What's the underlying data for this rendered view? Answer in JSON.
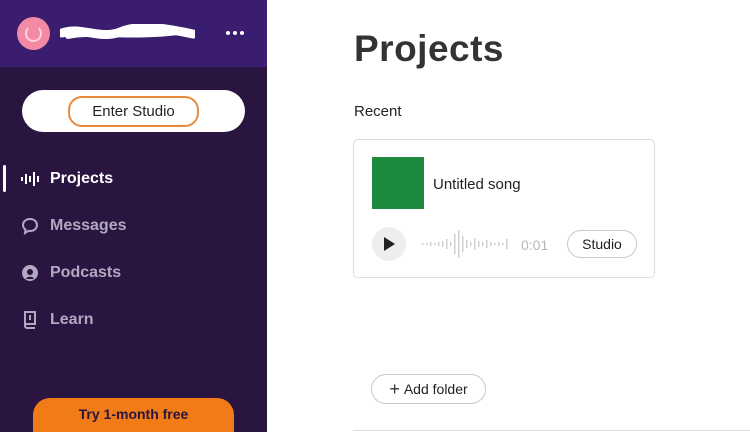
{
  "sidebar": {
    "more_label": "More options",
    "enter_studio_label": "Enter Studio",
    "nav": [
      {
        "label": "Projects",
        "icon": "waveform-icon",
        "active": true
      },
      {
        "label": "Messages",
        "icon": "chat-bubble-icon",
        "active": false
      },
      {
        "label": "Podcasts",
        "icon": "podcast-icon",
        "active": false
      },
      {
        "label": "Learn",
        "icon": "book-icon",
        "active": false
      }
    ],
    "try_free_label": "Try 1-month free"
  },
  "main": {
    "title": "Projects",
    "section_label": "Recent",
    "projects": [
      {
        "title": "Untitled song",
        "duration": "0:01",
        "studio_label": "Studio",
        "thumbnail_color": "#1d8a3f"
      }
    ],
    "add_folder_label": "Add folder"
  },
  "colors": {
    "sidebar_bg": "#2a1540",
    "sidebar_header_bg": "#3a1d6e",
    "accent_orange": "#f07b17",
    "avatar_pink": "#f38aa5"
  }
}
